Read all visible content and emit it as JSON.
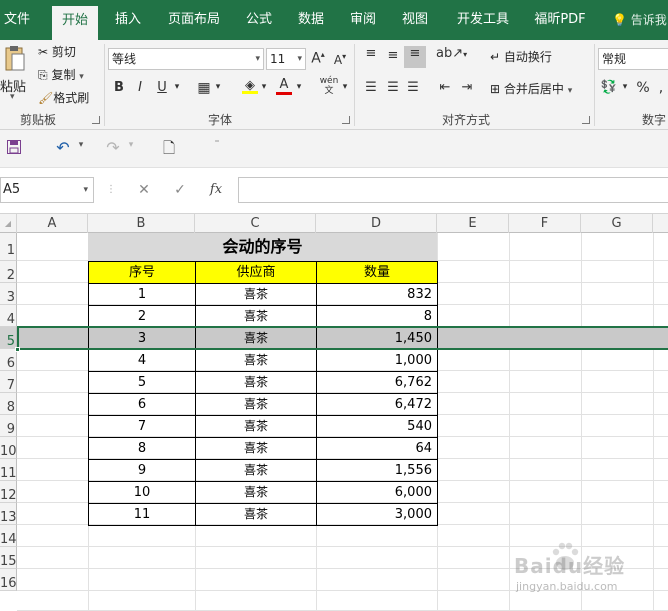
{
  "ribbon_tabs": [
    "文件",
    "开始",
    "插入",
    "页面布局",
    "公式",
    "数据",
    "审阅",
    "视图",
    "开发工具",
    "福昕PDF"
  ],
  "active_tab": "开始",
  "tell_me": "告诉我",
  "clipboard": {
    "paste": "粘贴",
    "cut": "剪切",
    "copy": "复制",
    "format_painter": "格式刷",
    "label": "剪贴板"
  },
  "font": {
    "name": "等线",
    "size": "11",
    "bold": "B",
    "italic": "I",
    "underline": "U",
    "grow": "A",
    "shrink": "A",
    "font_color": "A",
    "phonetic": "wén",
    "label": "字体"
  },
  "alignment": {
    "wrap_text": "自动换行",
    "merge_center": "合并后居中",
    "label": "对齐方式"
  },
  "number": {
    "format": "常规",
    "percent": "%",
    "label": "数字"
  },
  "name_box": "A5",
  "fx_label": "fx",
  "columns": [
    "A",
    "B",
    "C",
    "D",
    "E",
    "F",
    "G"
  ],
  "rows": [
    "1",
    "2",
    "3",
    "4",
    "5",
    "6",
    "7",
    "8",
    "9",
    "10",
    "11",
    "12",
    "13",
    "14",
    "15",
    "16"
  ],
  "sheet": {
    "title": "会动的序号",
    "headers": [
      "序号",
      "供应商",
      "数量"
    ],
    "records": [
      {
        "no": "1",
        "supplier": "喜茶",
        "qty": "832"
      },
      {
        "no": "2",
        "supplier": "喜茶",
        "qty": "8"
      },
      {
        "no": "3",
        "supplier": "喜茶",
        "qty": "1,450"
      },
      {
        "no": "4",
        "supplier": "喜茶",
        "qty": "1,000"
      },
      {
        "no": "5",
        "supplier": "喜茶",
        "qty": "6,762"
      },
      {
        "no": "6",
        "supplier": "喜茶",
        "qty": "6,472"
      },
      {
        "no": "7",
        "supplier": "喜茶",
        "qty": "540"
      },
      {
        "no": "8",
        "supplier": "喜茶",
        "qty": "64"
      },
      {
        "no": "9",
        "supplier": "喜茶",
        "qty": "1,556"
      },
      {
        "no": "10",
        "supplier": "喜茶",
        "qty": "6,000"
      },
      {
        "no": "11",
        "supplier": "喜茶",
        "qty": "3,000"
      }
    ]
  },
  "selected_row": "5",
  "colors": {
    "accent": "#217346",
    "header_fill": "#ffff00",
    "title_fill": "#d9d9d9",
    "selected_row_fill": "#c9c9c9"
  },
  "watermark": {
    "brand": "Baidu经验",
    "url": "jingyan.baidu.com"
  }
}
